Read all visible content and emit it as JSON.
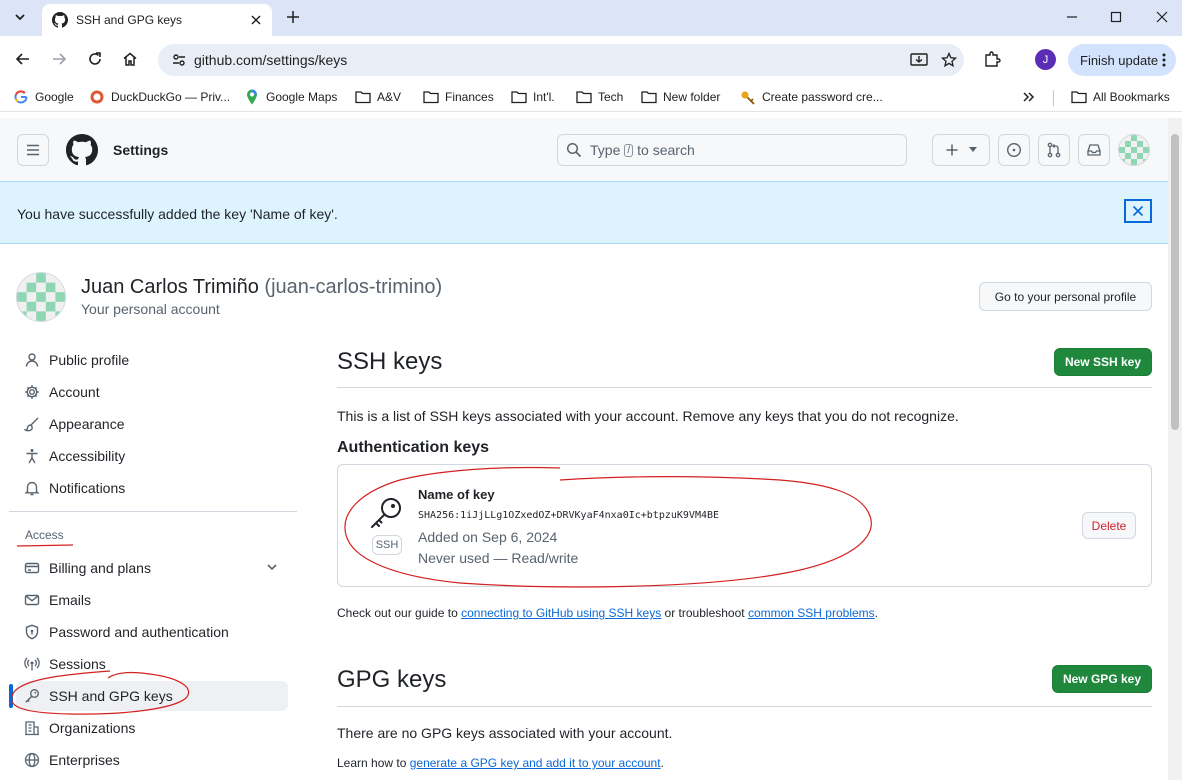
{
  "browser": {
    "tab_title": "SSH and GPG keys",
    "url": "github.com/settings/keys",
    "profile_initial": "J",
    "finish_update_label": "Finish update",
    "bookmarks": [
      {
        "label": "Google",
        "icon": "google-icon"
      },
      {
        "label": "DuckDuckGo — Priv...",
        "icon": "duckduckgo-icon"
      },
      {
        "label": "Google Maps",
        "icon": "google-maps-icon"
      },
      {
        "label": "A&V",
        "icon": "folder-icon"
      },
      {
        "label": "Finances",
        "icon": "folder-icon"
      },
      {
        "label": "Int'l.",
        "icon": "folder-icon"
      },
      {
        "label": "Tech",
        "icon": "folder-icon"
      },
      {
        "label": "New folder",
        "icon": "folder-icon"
      },
      {
        "label": "Create password cre...",
        "icon": "key-icon"
      }
    ],
    "all_bookmarks_label": "All Bookmarks"
  },
  "header": {
    "context": "Settings",
    "search_before": "Type",
    "search_key": "/",
    "search_after": "to search"
  },
  "flash": {
    "message": "You have successfully added the key 'Name of key'."
  },
  "user": {
    "name": "Juan Carlos Trimiño",
    "login": "(juan-carlos-trimino)",
    "subtitle": "Your personal account",
    "profile_button": "Go to your personal profile"
  },
  "sidebar": {
    "items": [
      {
        "label": "Public profile",
        "icon": "person-icon"
      },
      {
        "label": "Account",
        "icon": "gear-icon"
      },
      {
        "label": "Appearance",
        "icon": "paintbrush-icon"
      },
      {
        "label": "Accessibility",
        "icon": "accessibility-icon"
      },
      {
        "label": "Notifications",
        "icon": "bell-icon"
      }
    ],
    "group_label": "Access",
    "access_items": [
      {
        "label": "Billing and plans",
        "icon": "credit-card-icon"
      },
      {
        "label": "Emails",
        "icon": "mail-icon"
      },
      {
        "label": "Password and authentication",
        "icon": "shield-lock-icon"
      },
      {
        "label": "Sessions",
        "icon": "broadcast-icon"
      },
      {
        "label": "SSH and GPG keys",
        "icon": "key-icon"
      },
      {
        "label": "Organizations",
        "icon": "organization-icon"
      },
      {
        "label": "Enterprises",
        "icon": "globe-icon"
      }
    ]
  },
  "ssh": {
    "title": "SSH keys",
    "new_button": "New SSH key",
    "description": "This is a list of SSH keys associated with your account. Remove any keys that you do not recognize.",
    "auth_heading": "Authentication keys",
    "key": {
      "title": "Name of key",
      "fingerprint": "SHA256:1iJjLLg1OZxedOZ+DRVKyaF4nxa0Ic+btpzuK9VM4BE",
      "added": "Added on Sep 6, 2024",
      "used": "Never used — Read/write",
      "badge": "SSH",
      "delete": "Delete"
    },
    "guide_before": "Check out our guide to",
    "guide_link": "connecting to GitHub using SSH keys",
    "guide_middle": "or troubleshoot",
    "guide_link2": "common SSH problems",
    "guide_end": "."
  },
  "gpg": {
    "title": "GPG keys",
    "new_button": "New GPG key",
    "empty": "There are no GPG keys associated with your account.",
    "learn_before": "Learn how to",
    "learn_link": "generate a GPG key and add it to your account",
    "learn_end": "."
  },
  "colors": {
    "accent": "#0969da",
    "primary_button": "#1f883d",
    "danger": "#d1242f",
    "flash_bg": "#ddf4ff",
    "annotation": "#d42020"
  }
}
